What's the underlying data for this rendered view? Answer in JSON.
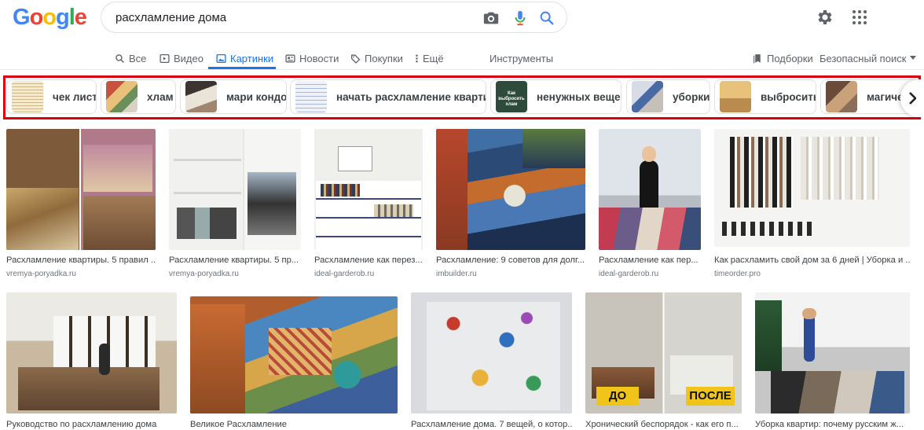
{
  "logo": {
    "letters": [
      "G",
      "o",
      "o",
      "g",
      "l",
      "e"
    ]
  },
  "search": {
    "query": "расхламление дома"
  },
  "header_icons": [
    "camera-icon",
    "microphone-icon",
    "search-icon",
    "settings-gear-icon",
    "apps-grid-icon"
  ],
  "tabs": [
    {
      "label": "Все",
      "icon": "search-icon"
    },
    {
      "label": "Видео",
      "icon": "play-icon"
    },
    {
      "label": "Картинки",
      "icon": "image-icon",
      "active": true
    },
    {
      "label": "Новости",
      "icon": "news-icon"
    },
    {
      "label": "Покупки",
      "icon": "tag-icon"
    },
    {
      "label": "Ещё",
      "icon": "more-vertical-icon"
    },
    {
      "label": "Инструменты"
    }
  ],
  "right_tools": {
    "collections": "Подборки",
    "safe_search": "Безопасный поиск"
  },
  "chips": [
    {
      "label": "чек лист"
    },
    {
      "label": "хлам"
    },
    {
      "label": "мари кондо"
    },
    {
      "label": "начать расхламление квартиры"
    },
    {
      "label": "ненужных вещей",
      "thumb_text": "Как выбросить хлам"
    },
    {
      "label": "уборки"
    },
    {
      "label": "выбросить"
    },
    {
      "label": "магичес"
    }
  ],
  "results": [
    {
      "title": "Расхламление квартиры. 5 правил ...",
      "site": "vremya-poryadka.ru"
    },
    {
      "title": "Расхламление квартиры. 5 пр...",
      "site": "vremya-poryadka.ru"
    },
    {
      "title": "Расхламление как перез...",
      "site": "ideal-garderob.ru"
    },
    {
      "title": "Расхламление: 9 советов для долг...",
      "site": "imbuilder.ru"
    },
    {
      "title": "Расхламление как пер...",
      "site": "ideal-garderob.ru"
    },
    {
      "title": "Как расхламить свой дом за 6 дней | Уборка и ...",
      "site": "timeorder.pro"
    },
    {
      "title": "Руководство по расхламлению дома",
      "site": ""
    },
    {
      "title": "Великое Расхламление",
      "site": ""
    },
    {
      "title": "Расхламление дома. 7 вещей, о котор...",
      "site": ""
    },
    {
      "title": "Хронический беспорядок - как его п...",
      "site": "",
      "overlay_left": "ДО",
      "overlay_right": "ПОСЛЕ"
    },
    {
      "title": "Уборка квартир: почему русским ж...",
      "site": ""
    }
  ],
  "colors": {
    "accent": "#1a73e8",
    "chip_frame": "#d9000d",
    "google_blue": "#4285f4",
    "google_red": "#ea4335",
    "google_yellow": "#fbbc05",
    "google_green": "#34a853"
  }
}
